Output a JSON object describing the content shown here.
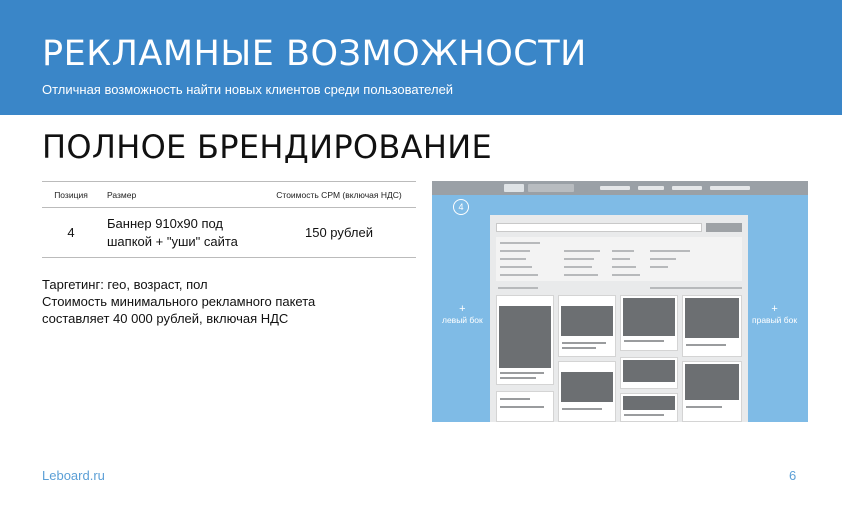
{
  "header": {
    "title": "РЕКЛАМНЫЕ ВОЗМОЖНОСТИ",
    "subtitle": "Отличная возможность найти новых клиентов среди пользователей"
  },
  "section": {
    "title": "ПОЛНОЕ БРЕНДИРОВАНИЕ"
  },
  "pricing_table": {
    "columns": [
      "Позиция",
      "Размер",
      "Стоимость CPM (включая НДС)"
    ],
    "rows": [
      {
        "position": "4",
        "size_line1": "Баннер 910x90 под",
        "size_line2": "шапкой + \"уши\" сайта",
        "price": "150 рублей"
      }
    ]
  },
  "notes": {
    "line1": "Таргетинг: гео, возраст, пол",
    "line2": "Стоимость минимального рекламного пакета",
    "line3": "составляет 40 000 рублей, включая НДС"
  },
  "screenshot": {
    "badge": "4",
    "left_side_label": "левый бок",
    "right_side_label": "правый бок",
    "plus_glyph": "+"
  },
  "footer": {
    "link": "Leboard.ru",
    "page_number": "6"
  },
  "colors": {
    "header_bg": "#3a86c8",
    "banner_bg": "#7fbbe6",
    "footer_text": "#5b9fd6"
  }
}
